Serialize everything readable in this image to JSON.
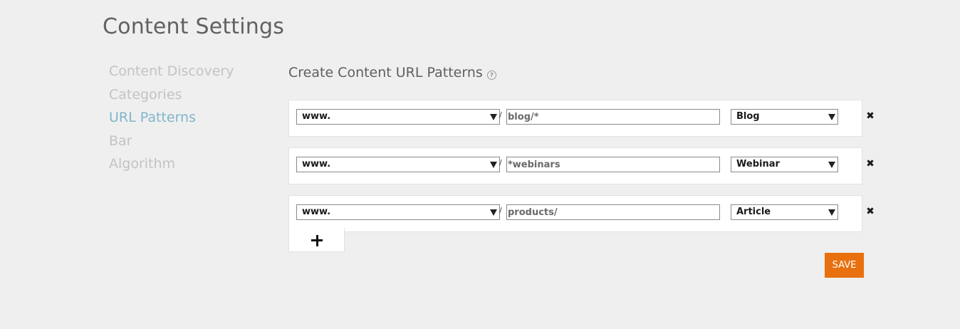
{
  "page": {
    "title": "Content Settings"
  },
  "sidebar": {
    "items": [
      {
        "label": "Content Discovery",
        "active": false
      },
      {
        "label": "Categories",
        "active": false
      },
      {
        "label": "URL Patterns",
        "active": true
      },
      {
        "label": "Bar",
        "active": false
      },
      {
        "label": "Algorithm",
        "active": false
      }
    ]
  },
  "main": {
    "section_title": "Create Content URL Patterns",
    "help_icon": "question-circle-icon",
    "separator": "/",
    "remove_icon": "close-x-icon",
    "add_icon": "plus-icon",
    "patterns": [
      {
        "domain": "www.",
        "path": "blog/*",
        "content_type": "Blog"
      },
      {
        "domain": "www.",
        "path": "*webinars",
        "content_type": "Webinar"
      },
      {
        "domain": "www.",
        "path": "products/",
        "content_type": "Article"
      }
    ],
    "save_label": "SAVE"
  },
  "colors": {
    "background": "#efefef",
    "active_nav": "#7fb5c9",
    "inactive_nav": "#c3c3c3",
    "save_button": "#e8700e"
  }
}
